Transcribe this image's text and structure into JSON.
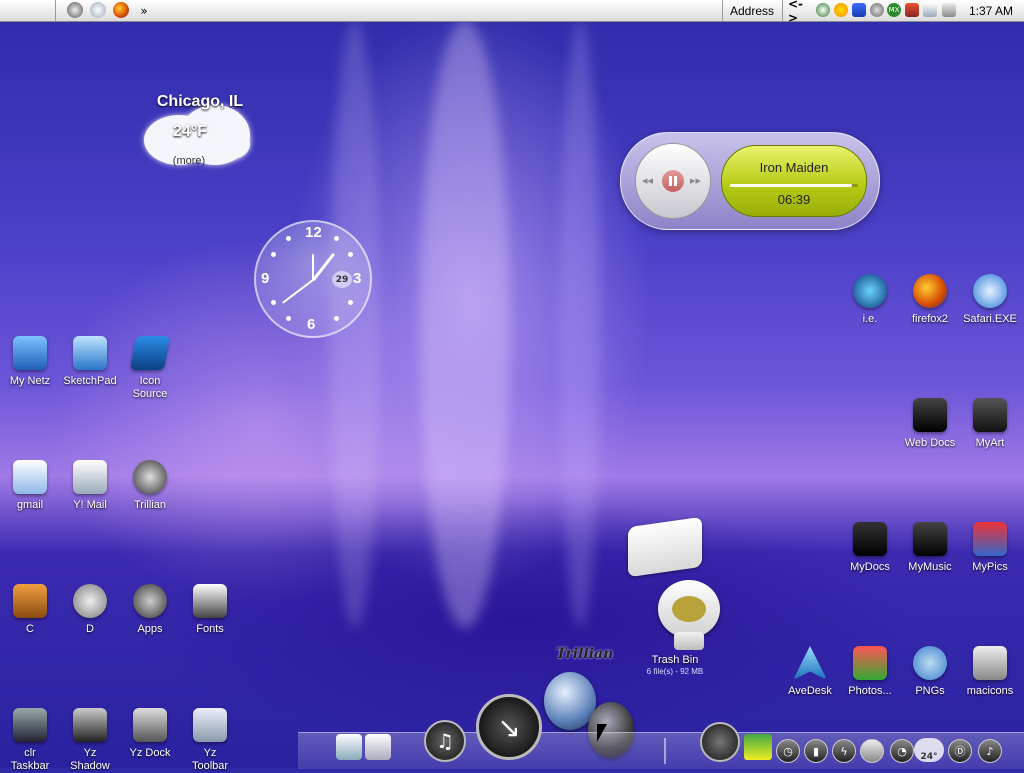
{
  "menubar": {
    "apple_glyph": "",
    "quicklaunch": [
      "settings-icon",
      "internet-explorer-icon",
      "firefox-icon"
    ],
    "overflow": "»",
    "address_label": "Address",
    "link_glyph": "<->",
    "tray_icons": [
      "network-icon",
      "sun-icon",
      "star-icon",
      "globe-icon",
      "mx-icon",
      "shield-icon",
      "mail-icon",
      "volume-icon"
    ],
    "mx_label": "MX",
    "clock": "1:37 AM"
  },
  "weather": {
    "city": "Chicago,  IL",
    "temp": "24°F",
    "more": "(more)"
  },
  "clock_widget": {
    "n12": "12",
    "n3": "3",
    "n6": "6",
    "n9": "9",
    "date": "29"
  },
  "media": {
    "title": "Iron Maiden",
    "time": "06:39",
    "progress": 0.95
  },
  "desktop": {
    "my_netz": "My Netz",
    "sketchpad": "SketchPad",
    "icon_source": "Icon\nSource",
    "gmail": "gmail",
    "ymail": "Y! Mail",
    "trillian": "Trillian",
    "c": "C",
    "d": "D",
    "apps": "Apps",
    "fonts": "Fonts",
    "clr_taskbar": "clr\nTaskbar",
    "yz_shadow": "Yz\nShadow",
    "yz_dock": "Yz Dock",
    "yz_toolbar": "Yz\nToolbar",
    "ie": "i.e.",
    "firefox2": "firefox2",
    "safari": "Safari.EXE",
    "web_docs": "Web Docs",
    "myart": "MyArt",
    "mydocs": "MyDocs",
    "mymusic": "MyMusic",
    "mypics": "MyPics",
    "avedesk": "AveDesk",
    "photos": "Photos...",
    "pngs": "PNGs",
    "macicons": "macicons"
  },
  "trash": {
    "label": "Trash Bin",
    "info": "6 file(s) - 92 MB"
  },
  "trillian_title": "Trillian",
  "dock": {
    "temp": "24°"
  }
}
